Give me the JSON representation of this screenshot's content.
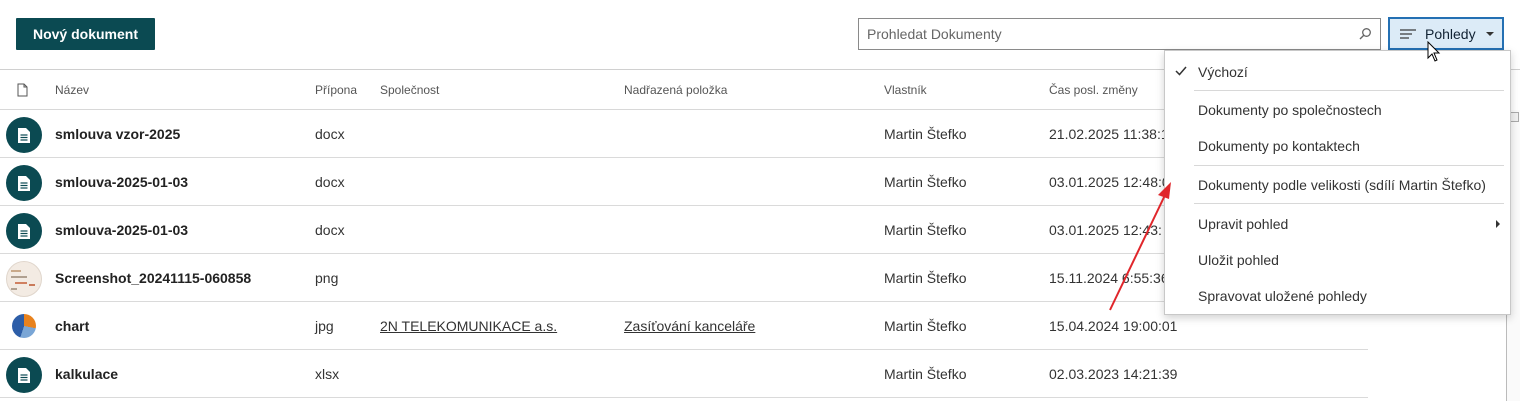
{
  "toolbar": {
    "new_document_label": "Nový dokument",
    "search_placeholder": "Prohledat Dokumenty",
    "views_label": "Pohledy"
  },
  "table": {
    "headers": {
      "name": "Název",
      "extension": "Přípona",
      "company": "Společnost",
      "parent": "Nadřazená položka",
      "owner": "Vlastník",
      "modified": "Čas posl. změny"
    },
    "rows": [
      {
        "name": "smlouva vzor-2025",
        "extension": "docx",
        "company": "",
        "parent": "",
        "owner": "Martin Štefko",
        "modified": "21.02.2025 11:38:1",
        "thumb": "document-icon"
      },
      {
        "name": "smlouva-2025-01-03",
        "extension": "docx",
        "company": "",
        "parent": "",
        "owner": "Martin Štefko",
        "modified": "03.01.2025 12:48:0",
        "thumb": "document-icon"
      },
      {
        "name": "smlouva-2025-01-03",
        "extension": "docx",
        "company": "",
        "parent": "",
        "owner": "Martin Štefko",
        "modified": "03.01.2025 12:43:",
        "thumb": "document-icon"
      },
      {
        "name": "Screenshot_20241115-060858",
        "extension": "png",
        "company": "",
        "parent": "",
        "owner": "Martin Štefko",
        "modified": "15.11.2024 6:55:36",
        "thumb": "image-thumbnail"
      },
      {
        "name": "chart",
        "extension": "jpg",
        "company": "2N TELEKOMUNIKACE a.s.",
        "parent": "Zasíťování kanceláře",
        "owner": "Martin Štefko",
        "modified": "15.04.2024 19:00:01",
        "thumb": "pie-chart-thumbnail"
      },
      {
        "name": "kalkulace",
        "extension": "xlsx",
        "company": "",
        "parent": "",
        "owner": "Martin Štefko",
        "modified": "02.03.2023 14:21:39",
        "thumb": "document-icon"
      }
    ]
  },
  "views_menu": {
    "items": [
      {
        "label": "Výchozí",
        "checked": true
      },
      {
        "label": "Dokumenty po společnostech"
      },
      {
        "label": "Dokumenty po kontaktech"
      },
      {
        "label": "Dokumenty podle velikosti (sdílí Martin Štefko)"
      },
      {
        "label": "Upravit pohled",
        "submenu": true
      },
      {
        "label": "Uložit pohled"
      },
      {
        "label": "Spravovat uložené pohledy"
      }
    ]
  },
  "colors": {
    "primary_button": "#0b4a52",
    "views_button_bg": "#dcebf7",
    "views_button_border": "#2470b3",
    "annotation_arrow": "#e0262b"
  }
}
